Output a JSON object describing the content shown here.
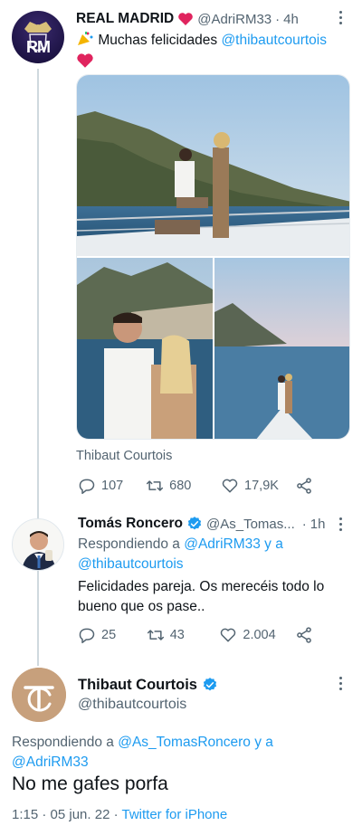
{
  "tweet1": {
    "display_name": "REAL MADRID",
    "handle": "@AdriRM33",
    "sep": "·",
    "time": "4h",
    "text_main": "Muchas felicidades ",
    "mention": "@thibautcourtois",
    "photo_caption": "Thibaut Courtois",
    "avatar_text": "RM",
    "stats": {
      "replies": "107",
      "retweets": "680",
      "likes": "17,9K"
    }
  },
  "tweet2": {
    "display_name": "Tomás Roncero",
    "handle": "@As_Tomas...",
    "sep": "·",
    "time": "1h",
    "replying_prefix": "Respondiendo a ",
    "replying_to_1": "@AdriRM33",
    "replying_and": " y a",
    "replying_to_2": "@thibautcourtois",
    "text": "Felicidades pareja. Os merecéis todo lo bueno que os pase..",
    "stats": {
      "replies": "25",
      "retweets": "43",
      "likes": "2.004"
    }
  },
  "tweet3": {
    "display_name": "Thibaut Courtois",
    "handle": "@thibautcourtois",
    "replying_prefix": "Respondiendo a ",
    "replying_to_1": "@As_TomasRoncero",
    "replying_and": " y a",
    "replying_to_2": "@AdriRM33",
    "text": "No me gafes porfa",
    "timestamp": "1:15 · 05 jun. 22 · ",
    "client": "Twitter for iPhone"
  },
  "colors": {
    "accent": "#1d9bf0",
    "verified": "#1d9bf0",
    "heart": "#e0245e",
    "muted": "#536471"
  },
  "icons": [
    "reply-icon",
    "retweet-icon",
    "like-icon",
    "share-icon",
    "verified-badge-icon",
    "party-popper-icon",
    "red-heart-icon",
    "more-icon"
  ]
}
